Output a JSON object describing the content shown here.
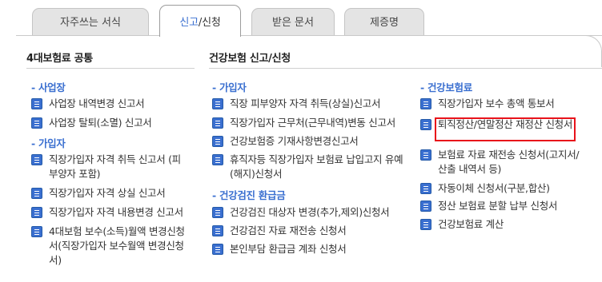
{
  "tabs": [
    {
      "label": "자주쓰는 서식",
      "active": false
    },
    {
      "label_part1": "신고",
      "label_part2": "/신청",
      "active": true
    },
    {
      "label": "받은 문서",
      "active": false
    },
    {
      "label": "제증명",
      "active": false
    }
  ],
  "columns": [
    {
      "title": "4대보험료 공통",
      "sections": [
        {
          "title": "- 사업장",
          "items": [
            "사업장 내역변경 신고서",
            "사업장 탈퇴(소멸) 신고서"
          ]
        },
        {
          "title": "- 가입자",
          "items": [
            "직장가입자 자격 취득 신고서 (피부양자 포함)",
            "직장가입자 자격 상실 신고서",
            "직장가입자 자격 내용변경 신고서",
            "4대보험 보수(소득)월액 변경신청서(직장가입자 보수월액 변경신청서)"
          ]
        }
      ]
    },
    {
      "title": "건강보험 신고/신청",
      "sections": [
        {
          "title": "- 가입자",
          "items": [
            "직장 피부양자 자격 취득(상실)신고서",
            "직장가입자 근무처(근무내역)변동 신고서",
            "건강보험증 기재사항변경신고서",
            "휴직자등 직장가입자 보험료 납입고지 유예(해지)신청서"
          ]
        },
        {
          "title": "- 건강검진 환급금",
          "items": [
            "건강검진 대상자 변경(추가,제외)신청서",
            "건강검진 자료 재전송 신청서",
            "본인부담 환급금 계좌 신청서"
          ]
        }
      ]
    },
    {
      "title": "",
      "sections": [
        {
          "title": "- 건강보험료",
          "items": [
            "직장가입자 보수 총액 통보서",
            "퇴직정산/연말정산 재정산 신청서",
            "보험료 자료 재전송 신청서(고지서/산출 내역서 등)",
            "자동이체 신청서(구분,합산)",
            "정산 보험료 분할 납부 신청서",
            "건강보험료 계산"
          ]
        }
      ]
    }
  ],
  "colors": {
    "accent": "#3a6fd0",
    "highlight": "#e8121a"
  }
}
